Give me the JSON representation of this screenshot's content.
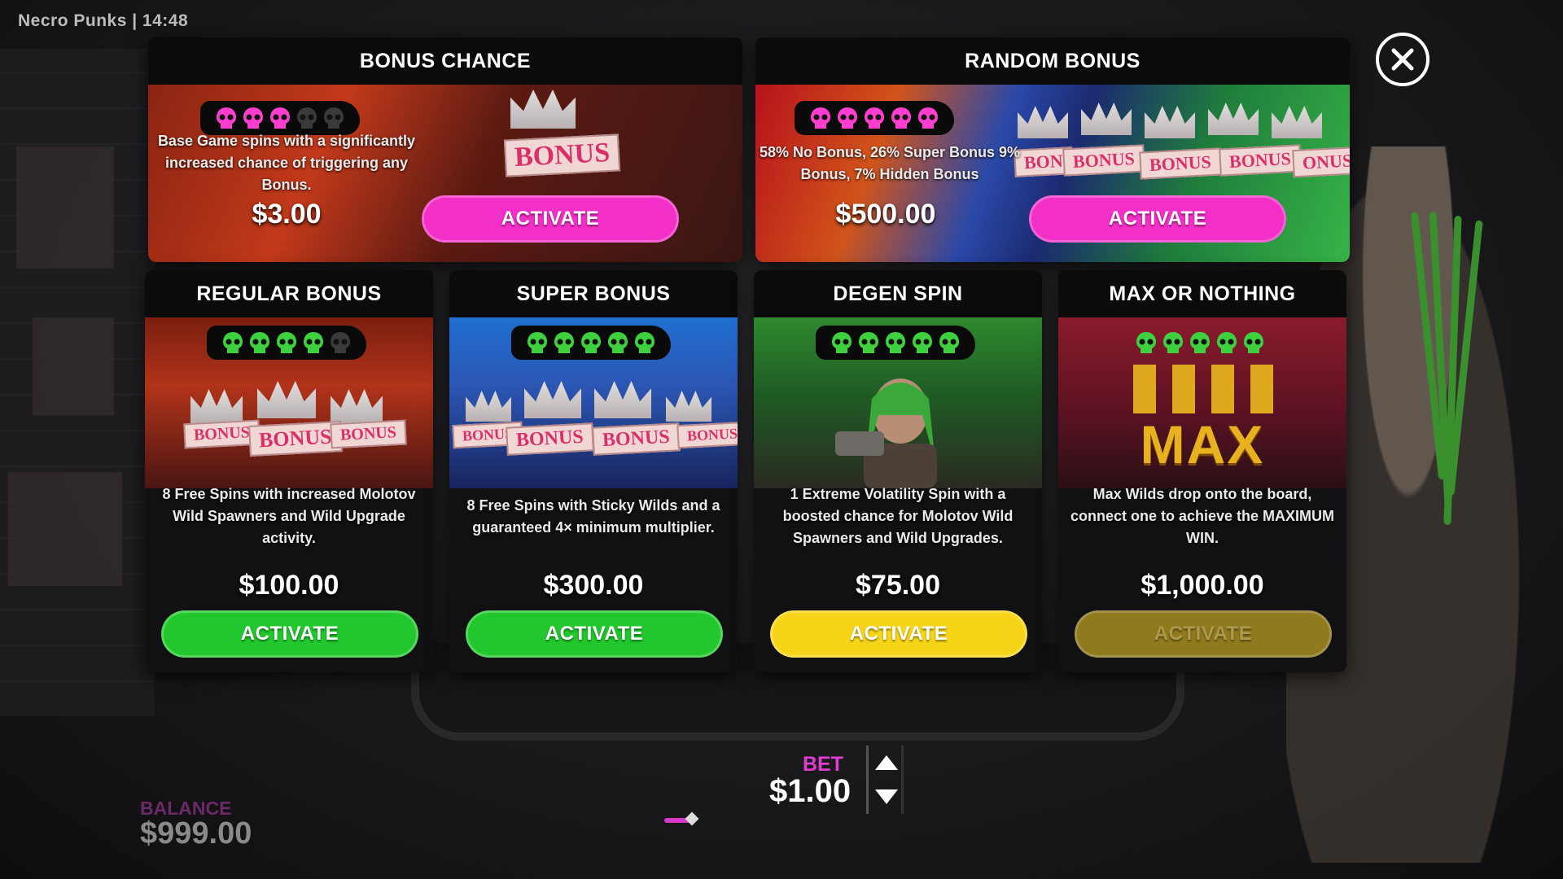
{
  "game": {
    "title": "Necro Punks | 14:48"
  },
  "close": {
    "icon": "close-icon"
  },
  "featured_cards": [
    {
      "title": "BONUS CHANCE",
      "skulls_active": 3,
      "skulls_total": 5,
      "skull_color": "#ff3ecf",
      "sign_text": "BONUS",
      "description": "Base Game spins with a significantly increased chance of triggering any Bonus.",
      "price": "$3.00",
      "button": "ACTIVATE",
      "button_color": "#f22fc7"
    },
    {
      "title": "RANDOM BONUS",
      "skulls_active": 5,
      "skulls_total": 5,
      "skull_color": "#ff3ecf",
      "sign_texts": [
        "BON",
        "BONUS",
        "BONUS",
        "BONUS",
        "ONUS"
      ],
      "description": "58% No Bonus, 26% Super Bonus 9% Bonus, 7% Hidden Bonus",
      "price": "$500.00",
      "button": "ACTIVATE",
      "button_color": "#f22fc7"
    }
  ],
  "cards": [
    {
      "title": "REGULAR BONUS",
      "skulls_active": 4,
      "skulls_total": 5,
      "skull_color": "#3fd03f",
      "sign_texts": [
        "BONUS",
        "BONUS",
        "BONUS"
      ],
      "description": "8 Free Spins with increased Molotov Wild Spawners and Wild Upgrade activity.",
      "price": "$100.00",
      "button": "ACTIVATE",
      "button_color": "#21c72d",
      "enabled": true
    },
    {
      "title": "SUPER BONUS",
      "skulls_active": 5,
      "skulls_total": 5,
      "skull_color": "#3fd03f",
      "sign_texts": [
        "BONUS",
        "BONUS",
        "BONUS",
        "BONUS"
      ],
      "description": "8 Free Spins with Sticky Wilds and a guaranteed 4× minimum multiplier.",
      "price": "$300.00",
      "button": "ACTIVATE",
      "button_color": "#21c72d",
      "enabled": true
    },
    {
      "title": "DEGEN SPIN",
      "skulls_active": 5,
      "skulls_total": 5,
      "skull_color": "#3fd03f",
      "description": "1 Extreme Volatility Spin with a boosted chance for Molotov Wild Spawners and Wild Upgrades.",
      "price": "$75.00",
      "button": "ACTIVATE",
      "button_color": "#f6d519",
      "enabled": true
    },
    {
      "title": "MAX OR NOTHING",
      "skulls_active": 5,
      "skulls_total": 5,
      "skull_color": "#3fd03f",
      "sign_text": "MAX",
      "description": "Max Wilds drop onto the board, connect one to achieve the MAXIMUM WIN.",
      "price": "$1,000.00",
      "button": "ACTIVATE",
      "button_color": "#a68d20",
      "enabled": false
    }
  ],
  "balance": {
    "label": "BALANCE",
    "value": "$999.00"
  },
  "bet": {
    "label": "BET",
    "value": "$1.00"
  },
  "bet_slider": {
    "fraction": 0.7
  }
}
